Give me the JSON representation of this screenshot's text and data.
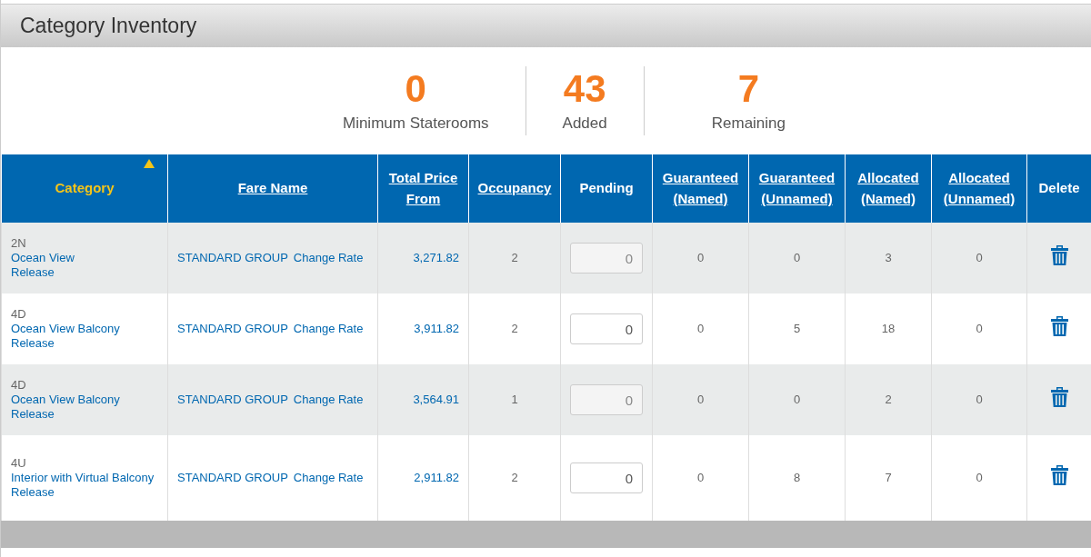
{
  "panel": {
    "title": "Category Inventory"
  },
  "stats": [
    {
      "value": "0",
      "label": "Minimum Staterooms"
    },
    {
      "value": "43",
      "label": "Added"
    },
    {
      "value": "7",
      "label": "Remaining"
    }
  ],
  "table": {
    "columns": [
      {
        "label": "Category",
        "sortable": true,
        "sorted": true
      },
      {
        "label": "Fare Name",
        "sortable": true,
        "sorted": false
      },
      {
        "label": "Total Price From",
        "sortable": true,
        "sorted": false
      },
      {
        "label": "Occupancy",
        "sortable": true,
        "sorted": false
      },
      {
        "label": "Pending",
        "sortable": false,
        "sorted": false
      },
      {
        "label": "Guaranteed (Named)",
        "sortable": true,
        "sorted": false
      },
      {
        "label": "Guaranteed (Unnamed)",
        "sortable": true,
        "sorted": false
      },
      {
        "label": "Allocated (Named)",
        "sortable": true,
        "sorted": false
      },
      {
        "label": "Allocated (Unnamed)",
        "sortable": true,
        "sorted": false
      },
      {
        "label": "Delete",
        "sortable": false,
        "sorted": false
      }
    ],
    "rows": [
      {
        "code": "2N",
        "name": "Ocean View",
        "release": "Release",
        "fare": "STANDARD GROUP",
        "change_rate": "Change Rate",
        "price": "3,271.82",
        "occupancy": "2",
        "pending": "0",
        "pending_disabled": true,
        "guaranteed_named": "0",
        "guaranteed_unnamed": "0",
        "allocated_named": "3",
        "allocated_unnamed": "0"
      },
      {
        "code": "4D",
        "name": "Ocean View Balcony",
        "release": "Release",
        "fare": "STANDARD GROUP",
        "change_rate": "Change Rate",
        "price": "3,911.82",
        "occupancy": "2",
        "pending": "0",
        "pending_disabled": false,
        "guaranteed_named": "0",
        "guaranteed_unnamed": "5",
        "allocated_named": "18",
        "allocated_unnamed": "0"
      },
      {
        "code": "4D",
        "name": "Ocean View Balcony",
        "release": "Release",
        "fare": "STANDARD GROUP",
        "change_rate": "Change Rate",
        "price": "3,564.91",
        "occupancy": "1",
        "pending": "0",
        "pending_disabled": true,
        "guaranteed_named": "0",
        "guaranteed_unnamed": "0",
        "allocated_named": "2",
        "allocated_unnamed": "0"
      },
      {
        "code": "4U",
        "name": "Interior with Virtual Balcony",
        "release": "Release",
        "fare": "STANDARD GROUP",
        "change_rate": "Change Rate",
        "price": "2,911.82",
        "occupancy": "2",
        "pending": "0",
        "pending_disabled": false,
        "guaranteed_named": "0",
        "guaranteed_unnamed": "8",
        "allocated_named": "7",
        "allocated_unnamed": "0"
      }
    ]
  }
}
